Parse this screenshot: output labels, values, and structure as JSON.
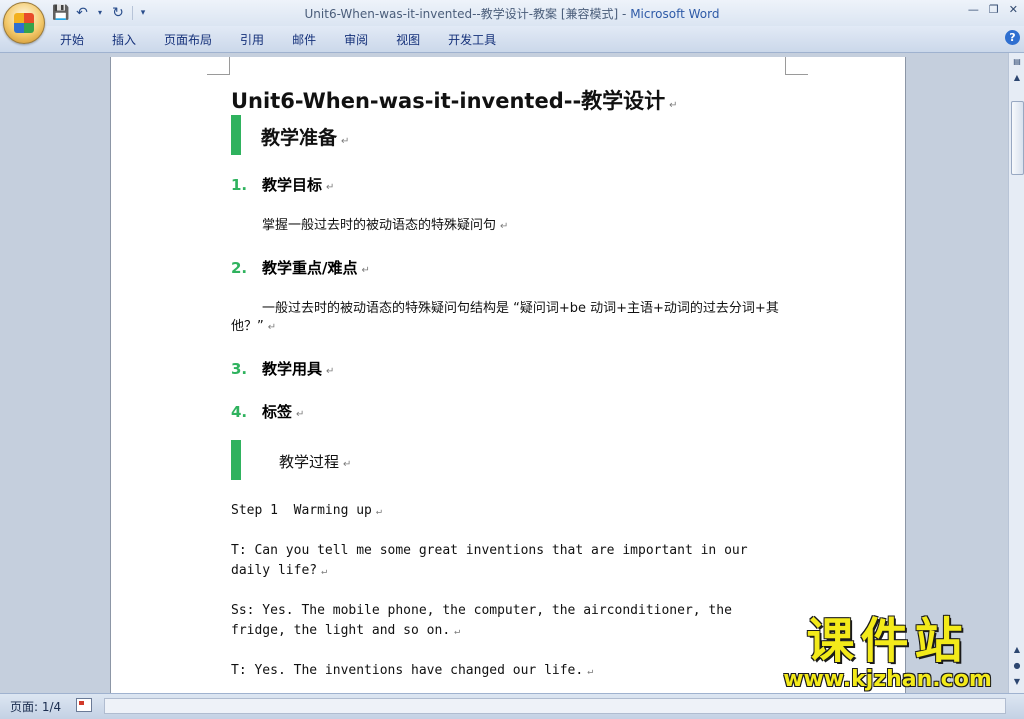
{
  "window": {
    "title_doc": "Unit6-When-was-it-invented--教学设计-教案 [兼容模式] - ",
    "title_app": "Microsoft Word"
  },
  "ribbon": {
    "tabs": [
      "开始",
      "插入",
      "页面布局",
      "引用",
      "邮件",
      "审阅",
      "视图",
      "开发工具"
    ]
  },
  "document": {
    "title": "Unit6-When-was-it-invented--教学设计",
    "section1": "教学准备",
    "items": [
      {
        "num": "1.",
        "label": "教学目标"
      },
      {
        "num": "2.",
        "label": "教学重点/难点"
      },
      {
        "num": "3.",
        "label": "教学用具"
      },
      {
        "num": "4.",
        "label": "标签"
      }
    ],
    "item1_body": "掌握一般过去时的被动语态的特殊疑问句",
    "item2_body": "一般过去时的被动语态的特殊疑问句结构是 “疑问词+be 动词+主语+动词的过去分词+其他？”",
    "section2": "教学过程",
    "lines": [
      "Step 1  Warming up",
      "T: Can you tell me some great inventions that are important in our daily life?",
      "Ss: Yes. The mobile phone, the computer, the airconditioner, the fridge, the light and so on.",
      "T: Yes. The inventions have changed our life."
    ]
  },
  "statusbar": {
    "page": "页面: 1/4"
  },
  "watermark": {
    "cn": "课件站",
    "url": "www.kjzhan.com"
  },
  "colors": {
    "accent_green": "#2fb25e",
    "watermark_yellow": "#f3ea1a",
    "word_blue": "#2e5aa7"
  }
}
